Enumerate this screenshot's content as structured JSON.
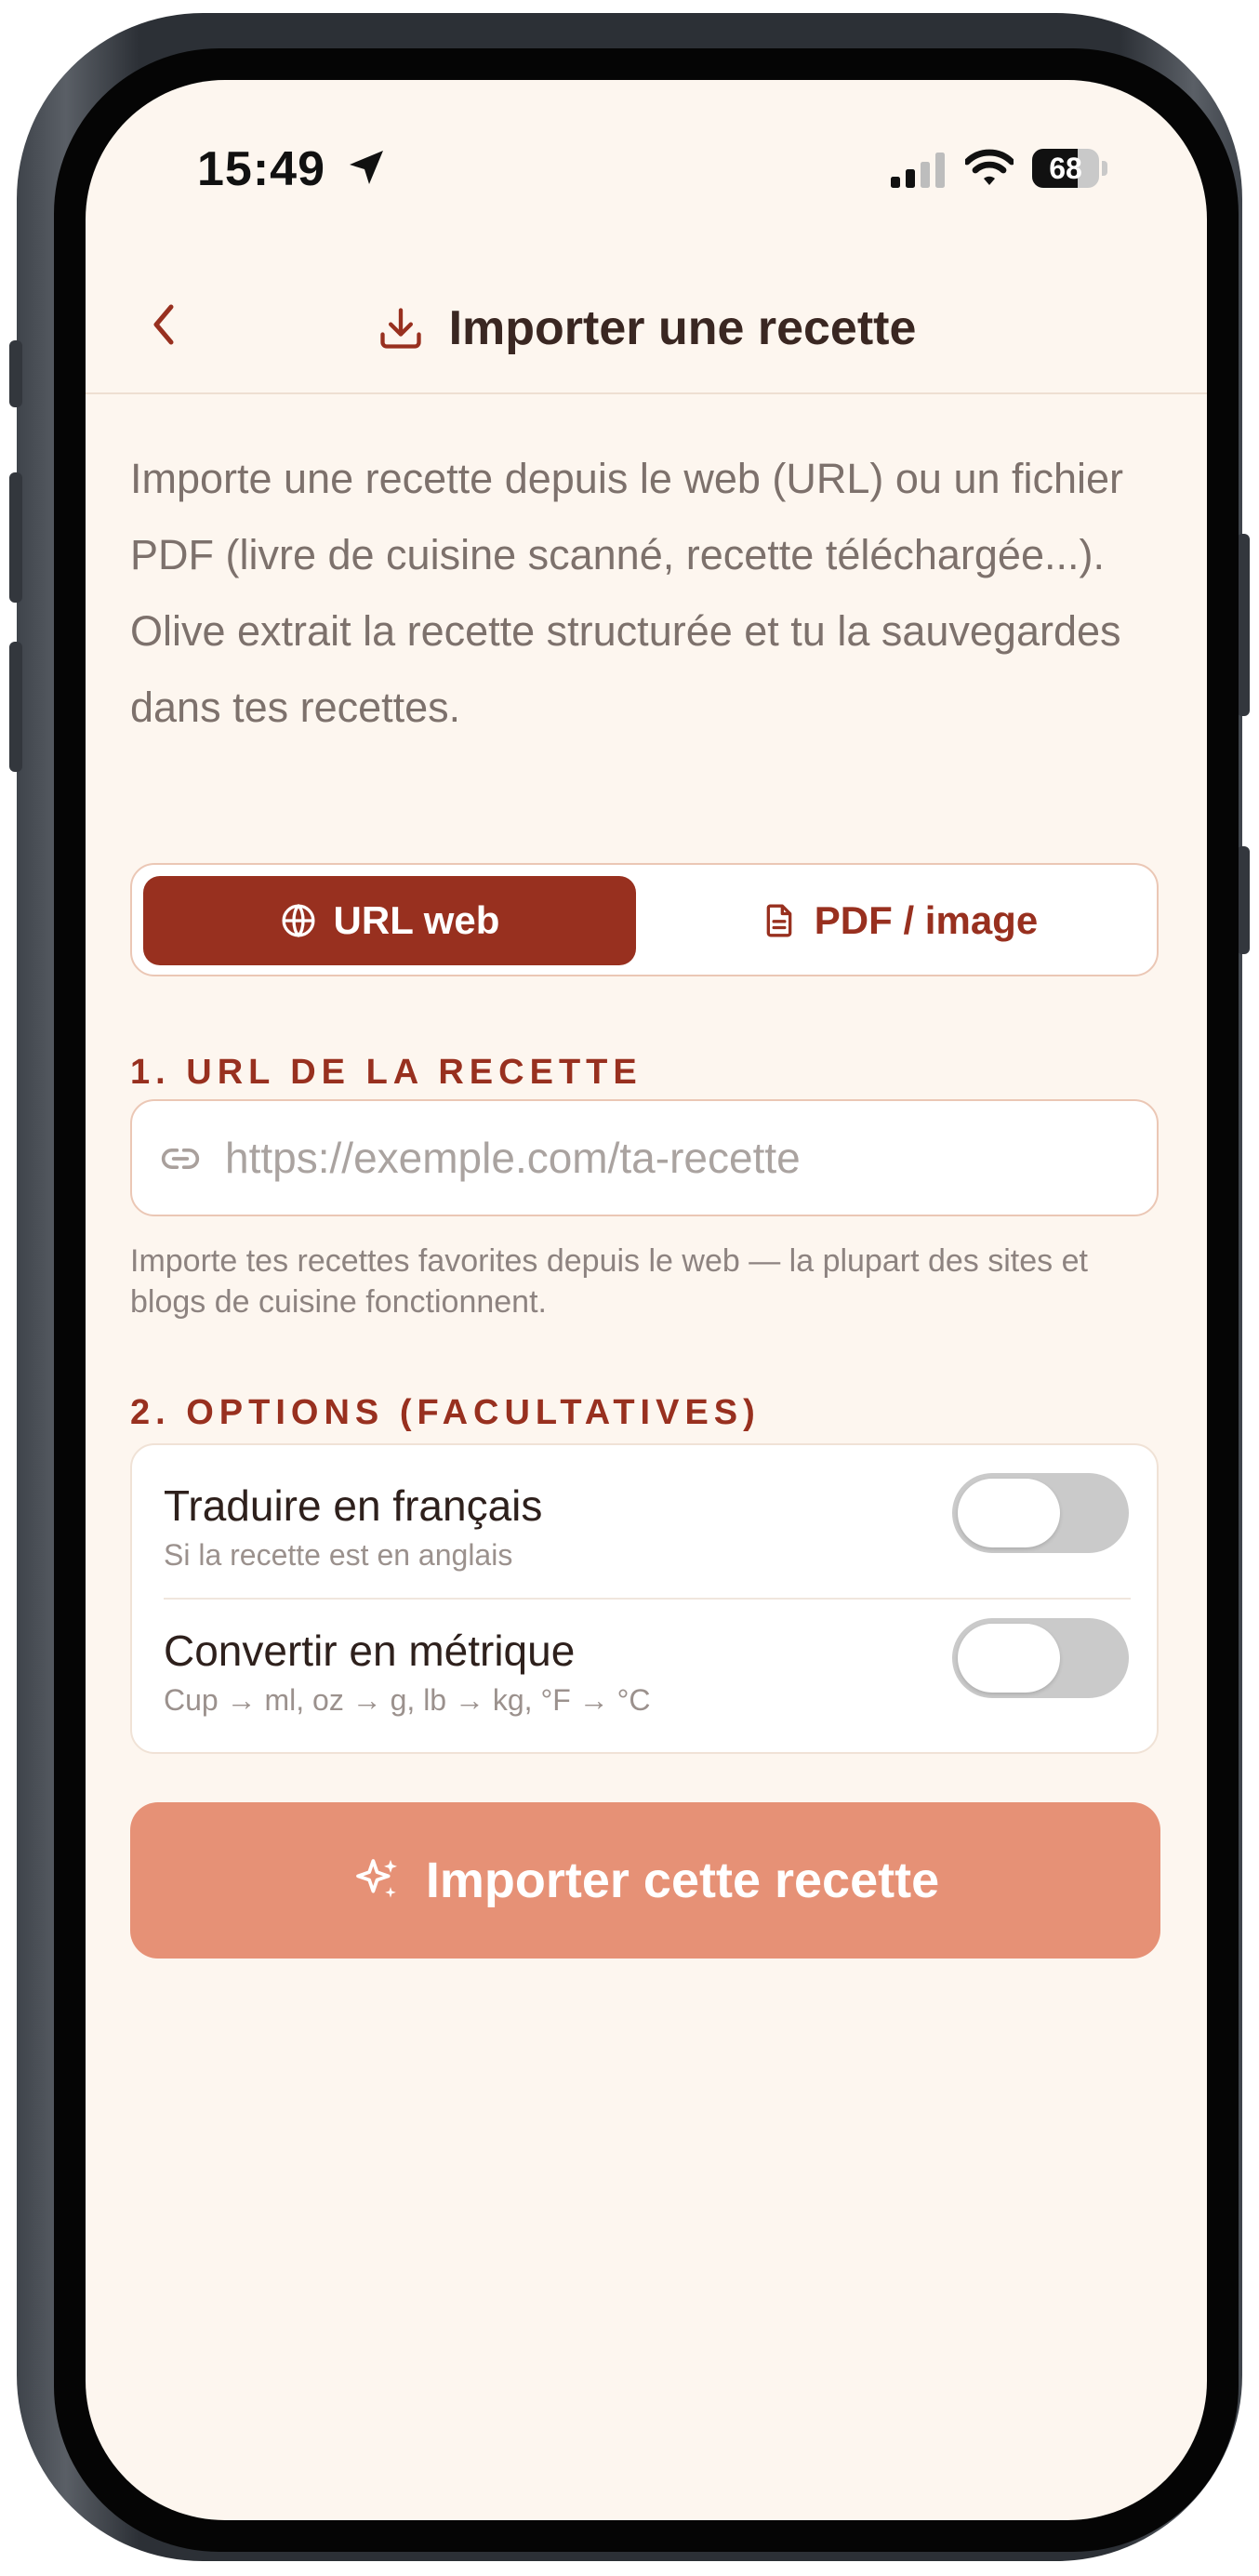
{
  "status_bar": {
    "time": "15:49",
    "battery": "68",
    "battery_level": 0.68
  },
  "header": {
    "title": "Importer une recette"
  },
  "intro": "Importe une recette depuis le web (URL) ou un fichier PDF (livre de cuisine scanné, recette téléchargée...). Olive extrait la recette structurée et tu la sauvegardes dans tes recettes.",
  "tabs": [
    {
      "label": "URL web",
      "icon": "globe-icon",
      "active": true
    },
    {
      "label": "PDF / image",
      "icon": "document-icon",
      "active": false
    }
  ],
  "url_section": {
    "label": "1. URL DE LA RECETTE",
    "placeholder": "https://exemple.com/ta-recette",
    "value": "",
    "hint": "Importe tes recettes favorites depuis le web — la plupart des sites et blogs de cuisine fonctionnent."
  },
  "options_section": {
    "label": "2. OPTIONS (FACULTATIVES)",
    "items": [
      {
        "title": "Traduire en français",
        "subtitle": "Si la recette est en anglais",
        "enabled": false
      },
      {
        "title": "Convertir en métrique",
        "subtitle": "Cup → ml, oz → g, lb → kg, °F → °C",
        "enabled": false
      }
    ]
  },
  "import_button": {
    "label": "Importer cette recette",
    "icon": "sparkles-icon"
  },
  "colors": {
    "background": "#fdf6ef",
    "accent": "#98301f",
    "button": "#e69176",
    "muted_text": "#7d716c"
  }
}
